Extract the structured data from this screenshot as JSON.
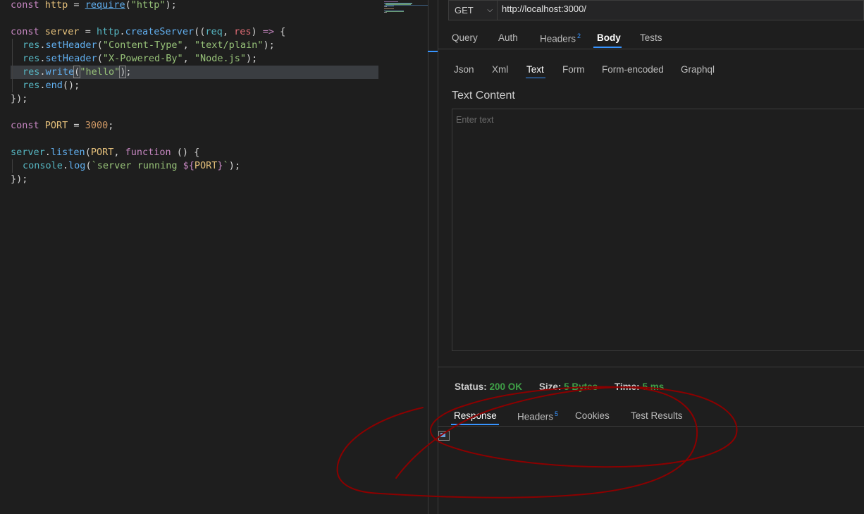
{
  "editor": {
    "lines": {
      "l1": {
        "kw": "const",
        "name": "http",
        "eq": " = ",
        "fn": "require",
        "open": "(",
        "str": "\"http\"",
        "close": ");"
      },
      "l3": {
        "kw": "const",
        "name": "server",
        "eq": " = ",
        "obj": "http",
        "dot": ".",
        "fn": "createServer",
        "open": "((",
        "p1": "req",
        "comma": ", ",
        "p2": "res",
        "close": ") ",
        "arrow": "=>",
        "brace": " {"
      },
      "l4": {
        "obj": "res",
        "dot": ".",
        "fn": "setHeader",
        "open": "(",
        "a1": "\"Content-Type\"",
        "comma": ", ",
        "a2": "\"text/plain\"",
        "close": ");"
      },
      "l5": {
        "obj": "res",
        "dot": ".",
        "fn": "setHeader",
        "open": "(",
        "a1": "\"X-Powered-By\"",
        "comma": ", ",
        "a2": "\"Node.js\"",
        "close": ");"
      },
      "l6": {
        "obj": "res",
        "dot": ".",
        "fn": "write",
        "open": "(",
        "a1": "\"hello\"",
        "close": ")",
        "semi": ";"
      },
      "l7": {
        "obj": "res",
        "dot": ".",
        "fn": "end",
        "rest": "();"
      },
      "l8": {
        "text": "});"
      },
      "l10": {
        "kw": "const",
        "name": "PORT",
        "eq": " = ",
        "num": "3000",
        "semi": ";"
      },
      "l12": {
        "obj": "server",
        "dot": ".",
        "fn": "listen",
        "open": "(",
        "a1": "PORT",
        "comma": ", ",
        "kw": "function",
        "rest": " () {"
      },
      "l13": {
        "obj": "console",
        "dot": ".",
        "fn": "log",
        "open": "(",
        "t1": "`server running ",
        "t2": "${",
        "v": "PORT",
        "t3": "}",
        "t4": "`",
        "close": ");"
      },
      "l14": {
        "text": "});"
      }
    }
  },
  "request": {
    "method": "GET",
    "url": "http://localhost:3000/",
    "tabs": [
      "Query",
      "Auth",
      "Headers",
      "Body",
      "Tests"
    ],
    "headers_count": "2",
    "body_tabs": [
      "Json",
      "Xml",
      "Text",
      "Form",
      "Form-encoded",
      "Graphql"
    ],
    "text_content_label": "Text Content",
    "text_placeholder": "Enter text"
  },
  "response": {
    "status_label": "Status:",
    "status_value": "200 OK",
    "size_label": "Size:",
    "size_value": "5 Bytes",
    "time_label": "Time:",
    "time_value": "5 ms",
    "tabs": [
      "Response",
      "Headers",
      "Cookies",
      "Test Results"
    ],
    "headers_count": "5"
  },
  "colors": {
    "accent": "#3794ff",
    "success": "#3fa047",
    "annotation": "#8b0000"
  },
  "icons": {
    "method_dropdown": "chevron-down-icon",
    "broken_image": "broken-image-icon"
  }
}
